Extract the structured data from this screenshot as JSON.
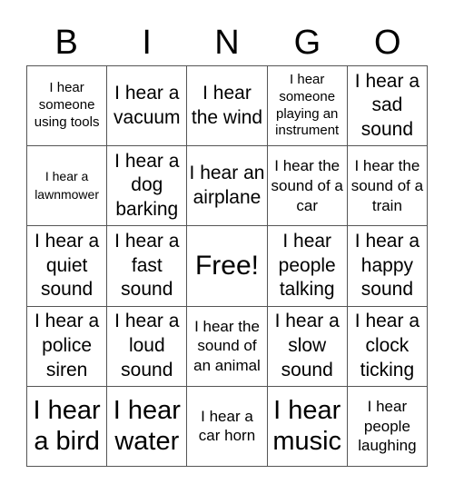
{
  "header": {
    "letters": [
      "B",
      "I",
      "N",
      "G",
      "O"
    ]
  },
  "grid": {
    "rows": [
      [
        "I hear someone using tools",
        "I hear a vacuum",
        "I hear the wind",
        "I hear someone playing an instrument",
        "I hear a sad sound"
      ],
      [
        "I hear a lawnmower",
        "I hear a dog barking",
        "I hear an airplane",
        "I hear the sound of a car",
        "I hear the sound of a train"
      ],
      [
        "I hear a quiet sound",
        "I hear a fast sound",
        "Free!",
        "I hear people talking",
        "I hear a happy sound"
      ],
      [
        "I hear a police siren",
        "I hear a loud sound",
        "I hear the sound of an animal",
        "I hear a slow sound",
        "I hear a clock ticking"
      ],
      [
        "I hear a bird",
        "I hear water",
        "I hear a car horn",
        "I hear music",
        "I hear people laughing"
      ]
    ]
  }
}
